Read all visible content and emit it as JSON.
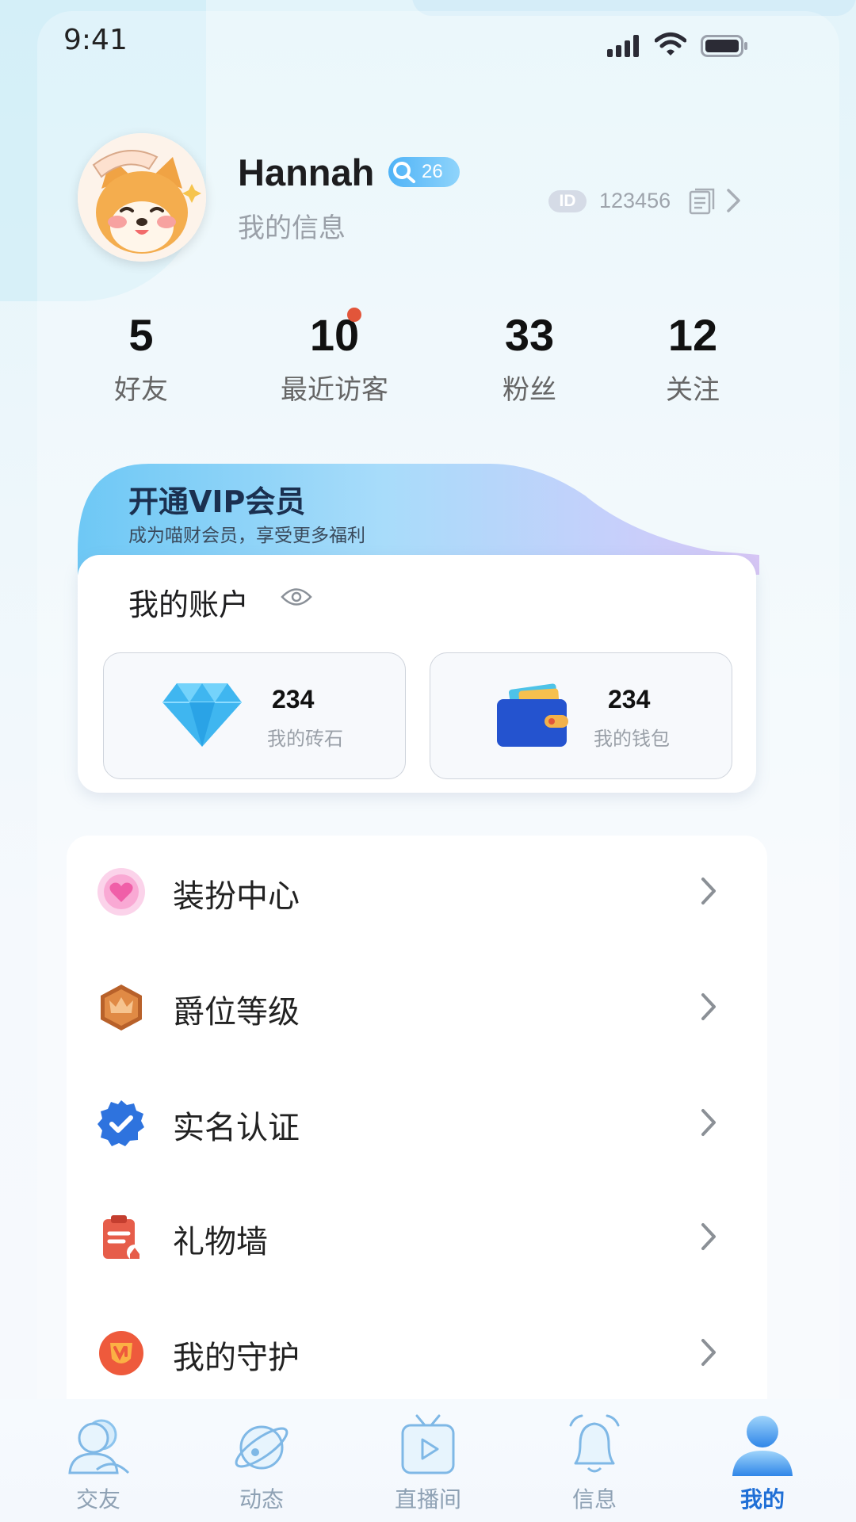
{
  "status_bar": {
    "time": "9:41"
  },
  "profile": {
    "name": "Hannah",
    "level": "26",
    "subtitle": "我的信息",
    "id_label": "ID",
    "id_value": "123456"
  },
  "stats": [
    {
      "value": "5",
      "label": "好友"
    },
    {
      "value": "10",
      "label": "最近访客"
    },
    {
      "value": "33",
      "label": "粉丝"
    },
    {
      "value": "12",
      "label": "关注"
    }
  ],
  "vip": {
    "title": "开通VIP会员",
    "subtitle": "成为喵财会员，享受更多福利"
  },
  "account": {
    "title": "我的账户",
    "diamonds": {
      "value": "234",
      "label": "我的砖石"
    },
    "wallet": {
      "value": "234",
      "label": "我的钱包"
    }
  },
  "menu": [
    {
      "label": "装扮中心",
      "icon": "heart-icon"
    },
    {
      "label": "爵位等级",
      "icon": "crown-badge-icon"
    },
    {
      "label": "实名认证",
      "icon": "verified-badge-icon"
    },
    {
      "label": "礼物墙",
      "icon": "clipboard-icon"
    },
    {
      "label": "我的守护",
      "icon": "shield-icon"
    }
  ],
  "tabs": [
    {
      "label": "交友",
      "icon": "friends-icon"
    },
    {
      "label": "动态",
      "icon": "planet-icon"
    },
    {
      "label": "直播间",
      "icon": "tv-play-icon"
    },
    {
      "label": "信息",
      "icon": "bell-icon"
    },
    {
      "label": "我的",
      "icon": "user-icon",
      "active": true
    }
  ],
  "colors": {
    "accent": "#1f6fd6",
    "tab_inactive": "#8ea1b4",
    "notify_dot": "#e2553a"
  }
}
